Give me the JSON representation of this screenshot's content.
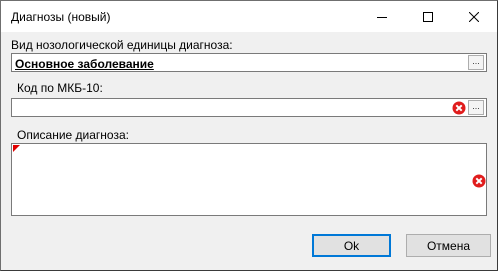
{
  "window": {
    "title": "Диагнозы (новый)"
  },
  "form": {
    "kind_label": "Вид нозологической единицы диагноза:",
    "kind_value": "Основное заболевание",
    "code_label": "Код по МКБ-10:",
    "code_value": "",
    "description_label": "Описание диагноза:",
    "description_value": "",
    "ellipsis": "..."
  },
  "buttons": {
    "ok": "Ok",
    "cancel": "Отмена"
  },
  "colors": {
    "clear_icon": "#e01c1c",
    "accent_border": "#0078d7"
  }
}
